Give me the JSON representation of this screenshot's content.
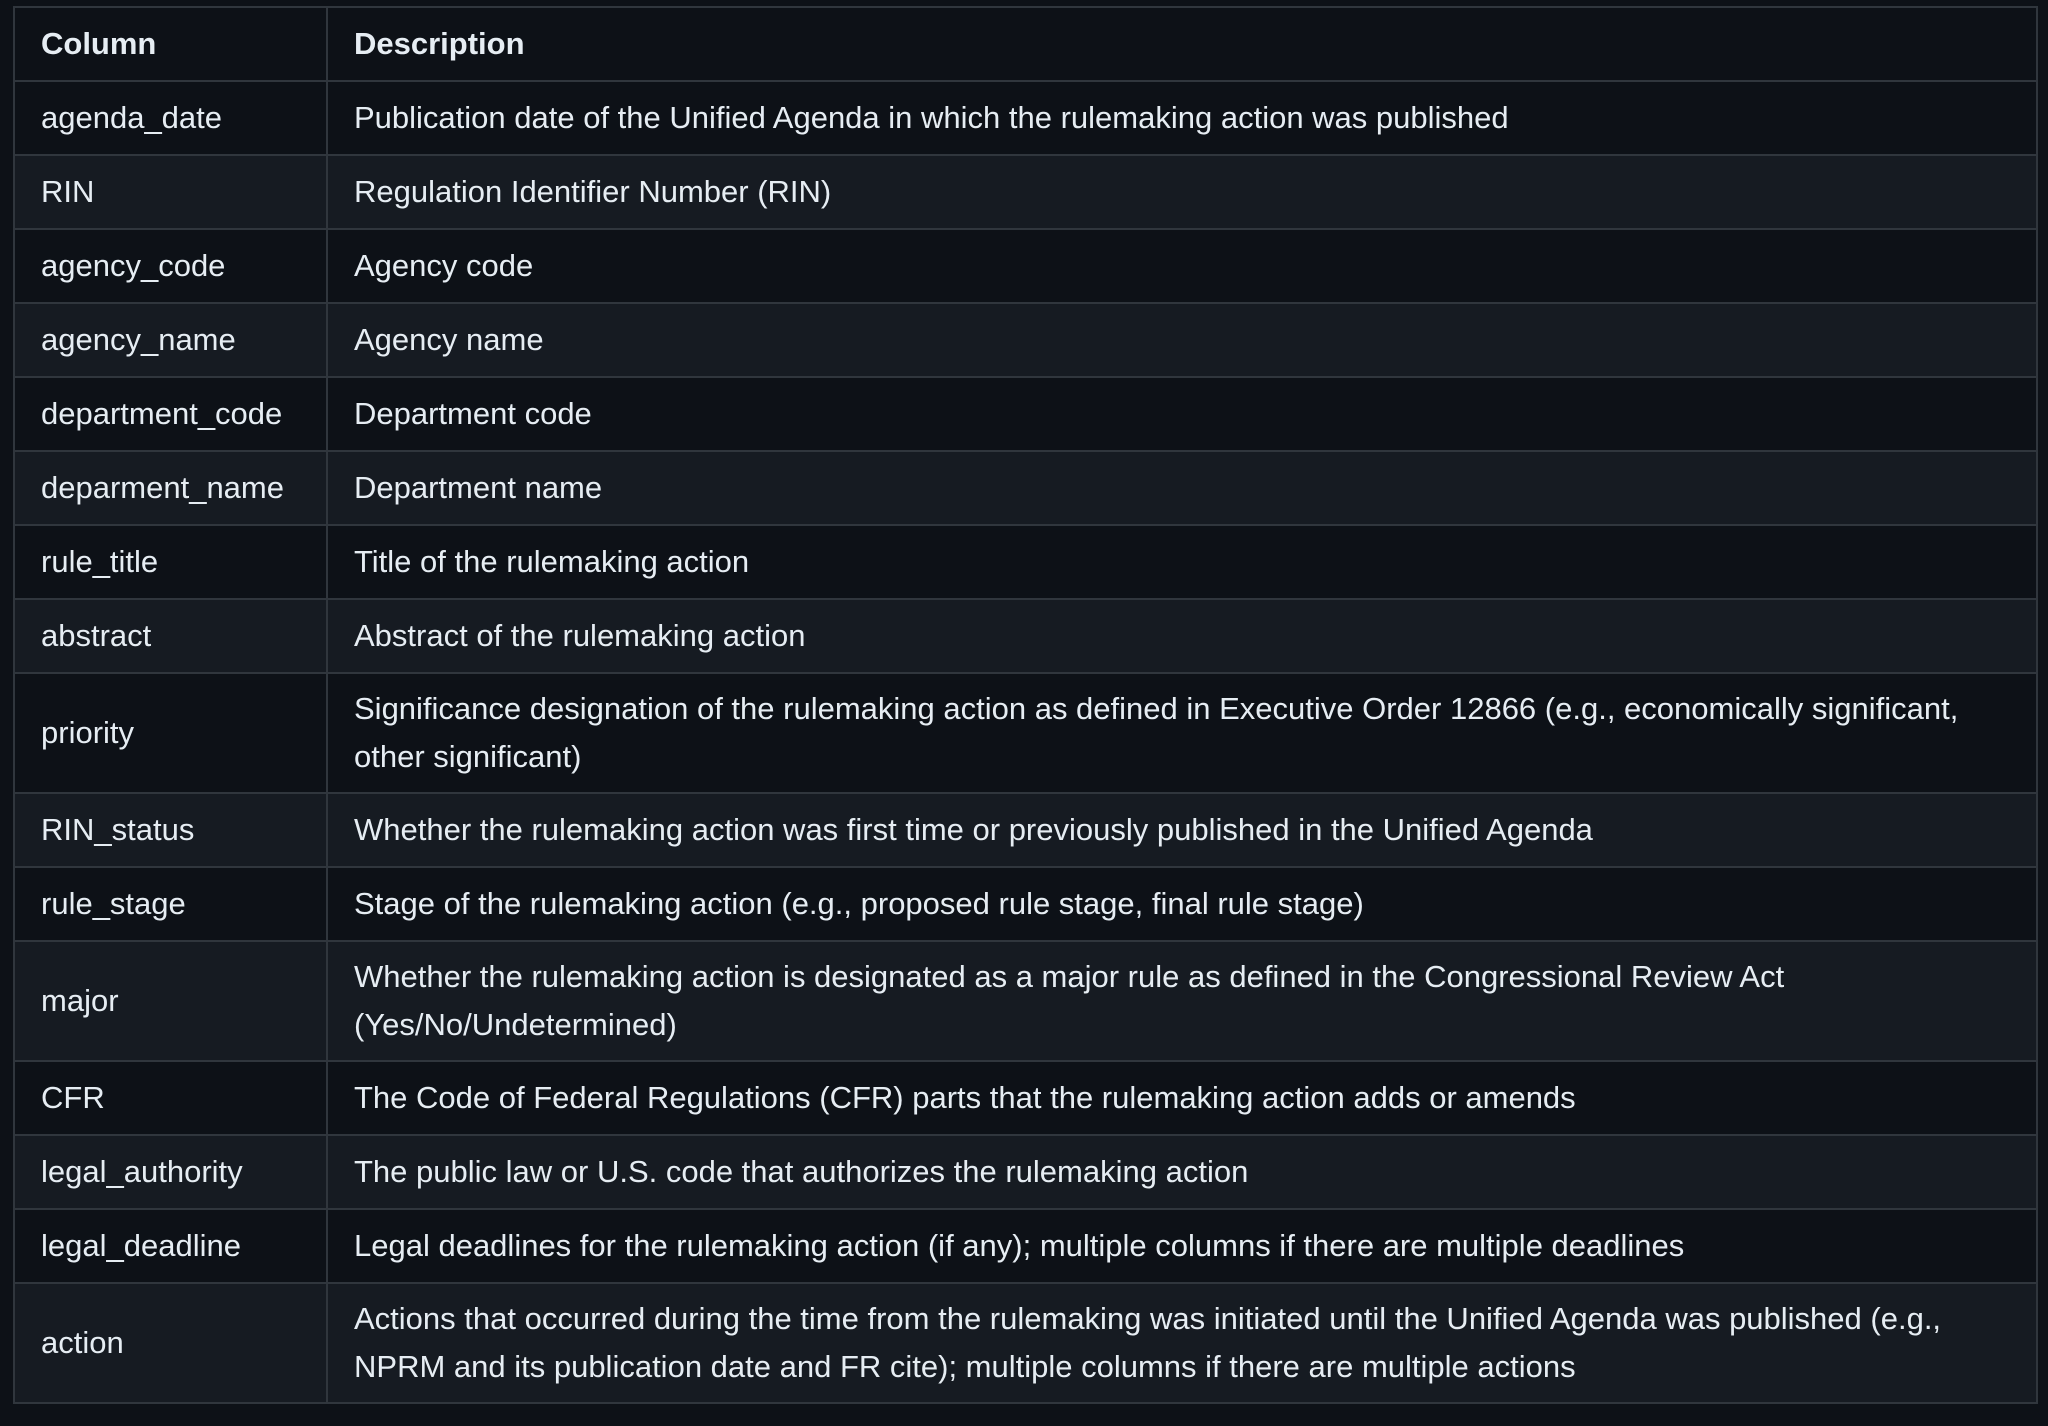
{
  "table": {
    "headers": [
      "Column",
      "Description"
    ],
    "rows": [
      {
        "column": "agenda_date",
        "description": "Publication date of the Unified Agenda in which the rulemaking action was published"
      },
      {
        "column": "RIN",
        "description": "Regulation Identifier Number (RIN)"
      },
      {
        "column": "agency_code",
        "description": "Agency code"
      },
      {
        "column": "agency_name",
        "description": "Agency name"
      },
      {
        "column": "department_code",
        "description": "Department code"
      },
      {
        "column": "deparment_name",
        "description": "Department name"
      },
      {
        "column": "rule_title",
        "description": "Title of the rulemaking action"
      },
      {
        "column": "abstract",
        "description": "Abstract of the rulemaking action"
      },
      {
        "column": "priority",
        "description": "Significance designation of the rulemaking action as defined in Executive Order 12866 (e.g., economically significant, other significant)"
      },
      {
        "column": "RIN_status",
        "description": "Whether the rulemaking action was first time or previously published in the Unified Agenda"
      },
      {
        "column": "rule_stage",
        "description": "Stage of the rulemaking action (e.g., proposed rule stage, final rule stage)"
      },
      {
        "column": "major",
        "description": "Whether the rulemaking action is designated as a major rule as defined in the Congressional Review Act (Yes/No/Undetermined)"
      },
      {
        "column": "CFR",
        "description": "The Code of Federal Regulations (CFR) parts that the rulemaking action adds or amends"
      },
      {
        "column": "legal_authority",
        "description": "The public law or U.S. code that authorizes the rulemaking action"
      },
      {
        "column": "legal_deadline",
        "description": "Legal deadlines for the rulemaking action (if any); multiple columns if there are multiple deadlines"
      },
      {
        "column": "action",
        "description": "Actions that occurred during the time from the rulemaking was initiated until the Unified Agenda was published (e.g., NPRM and its publication date and FR cite); multiple columns if there are multiple actions"
      }
    ]
  }
}
